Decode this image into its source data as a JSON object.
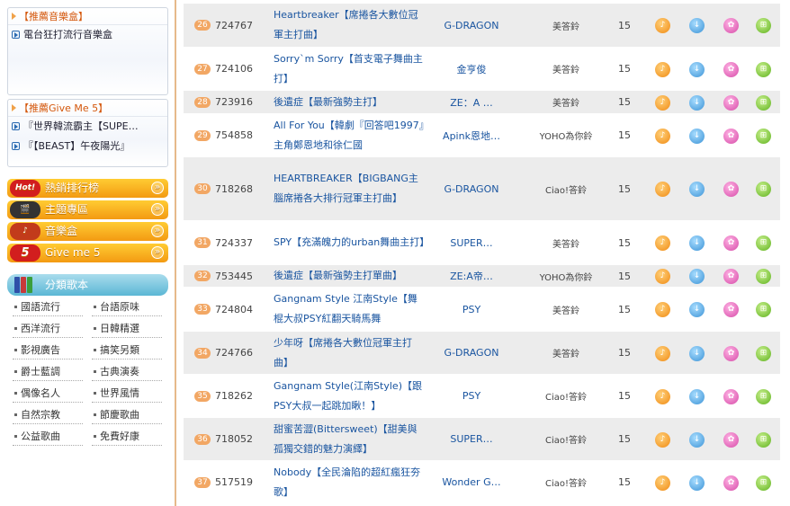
{
  "sidebar": {
    "box1": {
      "title": "【推薦音樂盒】",
      "items": [
        "電台狂打流行音樂盒"
      ]
    },
    "box2": {
      "title": "【推薦Give Me 5】",
      "items": [
        "『世界韓流霸主【SUPE…",
        "『【BEAST】午夜陽光』"
      ]
    },
    "menu": [
      {
        "badge": "Hot!",
        "label": "熱銷排行榜"
      },
      {
        "badge": "🎬",
        "label": "主題專區"
      },
      {
        "badge": "♪",
        "label": "音樂盒"
      },
      {
        "badge": "5",
        "label": "Give me 5"
      }
    ],
    "category_title": "分類歌本",
    "categories": [
      "國語流行",
      "台語原味",
      "西洋流行",
      "日韓精選",
      "影視廣告",
      "搞笑另類",
      "爵士藍調",
      "古典演奏",
      "偶像名人",
      "世界風情",
      "自然宗教",
      "節慶歌曲",
      "公益歌曲",
      "免費好康"
    ]
  },
  "songs": [
    {
      "rank": "26",
      "code": "724767",
      "title": "Heartbreaker【席捲各大數位冠軍主打曲】",
      "artist": "G-DRAGON",
      "album": "美答鈴",
      "count": "15"
    },
    {
      "rank": "27",
      "code": "724106",
      "title": "Sorry`m Sorry【首支電子舞曲主打】",
      "artist": "金亨俊",
      "album": "美答鈴",
      "count": "15"
    },
    {
      "rank": "28",
      "code": "723916",
      "title": "後遺症【最新強勢主打】",
      "artist": "ZE：A …",
      "album": "美答鈴",
      "count": "15"
    },
    {
      "rank": "29",
      "code": "754858",
      "title": "All For You【韓劇『回答吧1997』主角鄭恩地和徐仁國",
      "artist": "Apink恩地…",
      "album": "YOHO為你鈴",
      "count": "15"
    },
    {
      "rank": "30",
      "code": "718268",
      "title": "HEARTBREAKER【BIGBANG主腦席捲各大排行冠軍主打曲】",
      "artist": "G-DRAGON",
      "album": "Ciao!答鈴",
      "count": "15"
    },
    {
      "rank": "31",
      "code": "724337",
      "title": "SPY【充滿魄力的urban舞曲主打】",
      "artist": "SUPER…",
      "album": "美答鈴",
      "count": "15"
    },
    {
      "rank": "32",
      "code": "753445",
      "title": "後遺症【最新強勢主打單曲】",
      "artist": "ZE:A帝…",
      "album": "YOHO為你鈴",
      "count": "15"
    },
    {
      "rank": "33",
      "code": "724804",
      "title": "Gangnam Style 江南Style【舞棍大叔PSY紅翻天騎馬舞",
      "artist": "PSY",
      "album": "美答鈴",
      "count": "15"
    },
    {
      "rank": "34",
      "code": "724766",
      "title": "少年呀【席捲各大數位冠軍主打曲】",
      "artist": "G-DRAGON",
      "album": "美答鈴",
      "count": "15"
    },
    {
      "rank": "35",
      "code": "718262",
      "title": "Gangnam Style(江南Style)【跟PSY大叔一起跳加瞅！】",
      "artist": "PSY",
      "album": "Ciao!答鈴",
      "count": "15"
    },
    {
      "rank": "36",
      "code": "718052",
      "title": "甜蜜苦澀(Bittersweet)【甜美與孤獨交錯的魅力演繹】",
      "artist": "SUPER…",
      "album": "Ciao!答鈴",
      "count": "15"
    },
    {
      "rank": "37",
      "code": "517519",
      "title": "Nobody【全民淪陷的超紅瘋狂夯歌】",
      "artist": "Wonder G…",
      "album": "Ciao!答鈴",
      "count": "15"
    }
  ],
  "icons": {
    "play": "play-icon",
    "download": "download-icon",
    "gift": "gift-icon",
    "cart": "cart-icon"
  }
}
